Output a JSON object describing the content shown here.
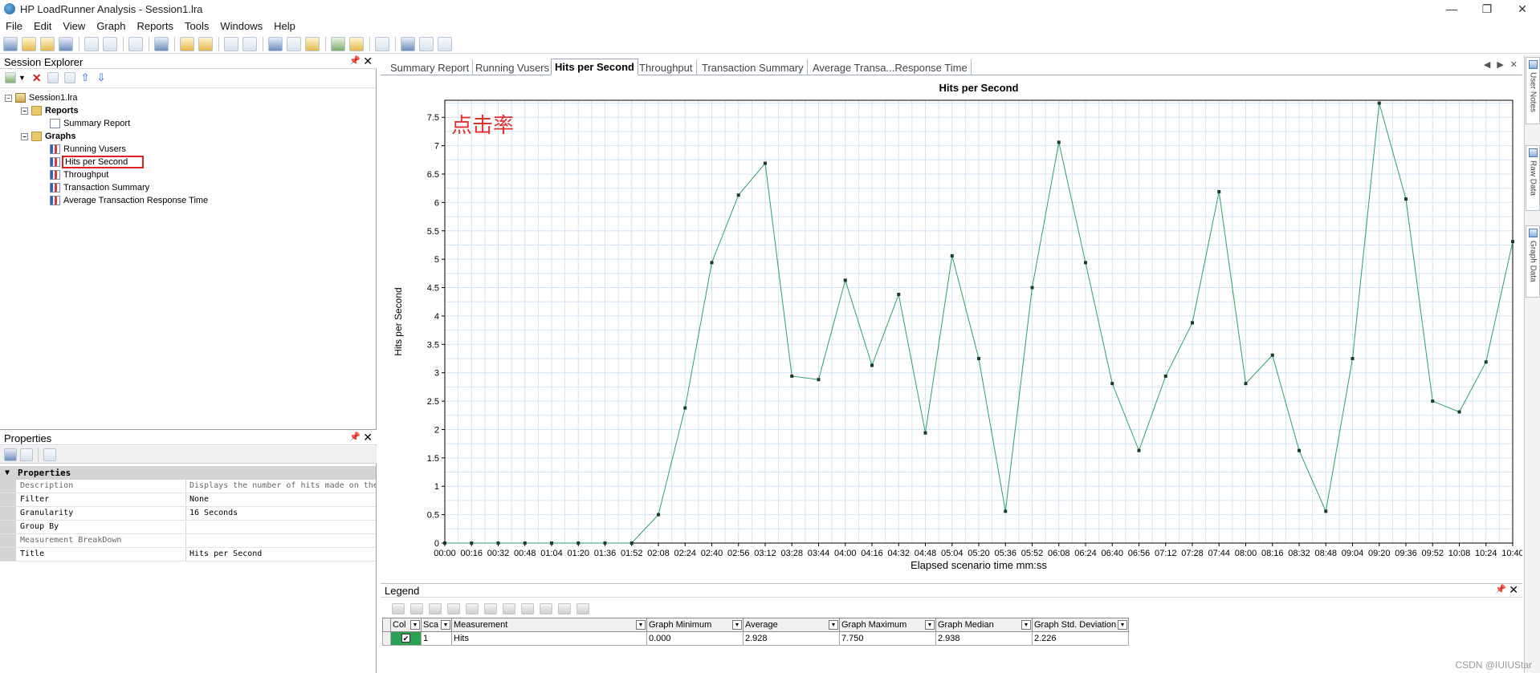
{
  "window": {
    "title": "HP LoadRunner Analysis - Session1.lra",
    "minimize": "—",
    "restore": "❐",
    "close": "✕"
  },
  "menu": [
    "File",
    "Edit",
    "View",
    "Graph",
    "Reports",
    "Tools",
    "Windows",
    "Help"
  ],
  "session_explorer": {
    "title": "Session Explorer",
    "tree": {
      "session": "Session1.lra",
      "reports": "Reports",
      "summary_report": "Summary Report",
      "graphs": "Graphs",
      "running_vusers": "Running Vusers",
      "hits_per_second": "Hits per Second",
      "throughput": "Throughput",
      "transaction_summary": "Transaction Summary",
      "avg_transaction_response_time": "Average Transaction Response Time"
    }
  },
  "properties": {
    "title": "Properties",
    "category": "Properties",
    "rows": [
      {
        "name": "Description",
        "value": "Displays the number of hits made on the"
      },
      {
        "name": "Filter",
        "value": "None"
      },
      {
        "name": "Granularity",
        "value": "16 Seconds"
      },
      {
        "name": "Group By",
        "value": ""
      },
      {
        "name": "Measurement BreakDown",
        "value": ""
      },
      {
        "name": "Title",
        "value": "Hits per Second"
      }
    ]
  },
  "tabs": [
    "Summary Report",
    "Running Vusers",
    "Hits per Second",
    "Throughput",
    "Transaction Summary",
    "Average Transa...Response Time"
  ],
  "active_tab": "Hits per Second",
  "tab_nav": {
    "prev": "◀",
    "next": "▶",
    "close": "✕"
  },
  "chart_data": {
    "type": "line",
    "title": "Hits per Second",
    "xlabel": "Elapsed scenario time mm:ss",
    "ylabel": "Hits per Second",
    "annotation": "点击率",
    "ylim": [
      0,
      7.8
    ],
    "yticks": [
      0,
      0.5,
      1,
      1.5,
      2,
      2.5,
      3,
      3.5,
      4,
      4.5,
      5,
      5.5,
      6,
      6.5,
      7,
      7.5
    ],
    "x": [
      "00:00",
      "00:16",
      "00:32",
      "00:48",
      "01:04",
      "01:20",
      "01:36",
      "01:52",
      "02:08",
      "02:24",
      "02:40",
      "02:56",
      "03:12",
      "03:28",
      "03:44",
      "04:00",
      "04:16",
      "04:32",
      "04:48",
      "05:04",
      "05:20",
      "05:36",
      "05:52",
      "06:08",
      "06:24",
      "06:40",
      "06:56",
      "07:12",
      "07:28",
      "07:44",
      "08:00",
      "08:16",
      "08:32",
      "08:48",
      "09:04",
      "09:20",
      "09:36",
      "09:52",
      "10:08",
      "10:24",
      "10:40"
    ],
    "grid": true,
    "line_color": "#2e9e6e",
    "series": [
      {
        "values": [
          0,
          0,
          0,
          0,
          0,
          0,
          0,
          0,
          0.5,
          2.38,
          4.94,
          6.13,
          6.69,
          2.94,
          2.88,
          4.63,
          3.13,
          4.38,
          1.94,
          5.06,
          3.25,
          0.56,
          4.5,
          7.06,
          4.94,
          2.81,
          1.63,
          2.94,
          3.88,
          6.19,
          2.81,
          3.31,
          1.63,
          0.56,
          3.25,
          7.75,
          6.06,
          2.5,
          2.31,
          3.19,
          5.31
        ]
      }
    ]
  },
  "legend": {
    "title": "Legend",
    "columns": [
      "Col",
      "Sca",
      "Measurement",
      "Graph Minimum",
      "Average",
      "Graph Maximum",
      "Graph Median",
      "Graph Std. Deviation"
    ],
    "rows": [
      {
        "color": "#2aa052",
        "checked": "✔",
        "scale": "1",
        "measurement": "Hits",
        "min": "0.000",
        "average": "2.928",
        "max": "7.750",
        "median": "2.938",
        "std": "2.226"
      }
    ]
  },
  "right_dock": [
    "User Notes",
    "Raw Data",
    "Graph Data"
  ],
  "watermark": "CSDN @IUIUStar"
}
